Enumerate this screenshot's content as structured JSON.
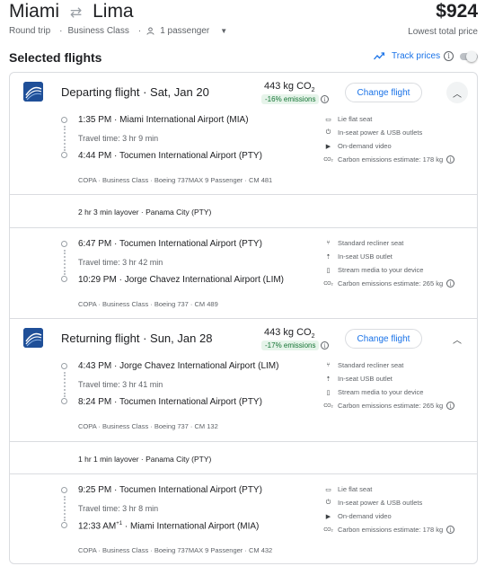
{
  "header": {
    "origin": "Miami",
    "swap_icon": "swap-arrows-icon",
    "destination": "Lima",
    "price": "$924",
    "trip_type": "Round trip",
    "cabin": "Business Class",
    "passengers": "1 passenger",
    "price_note": "Lowest total price"
  },
  "selected": {
    "title": "Selected flights",
    "track_prices": "Track prices",
    "track_enabled": false
  },
  "departing": {
    "title": "Departing flight",
    "date": "Sat, Jan 20",
    "co2": "443 kg CO",
    "co2_sub": "2",
    "emissions": "-16% emissions",
    "change_label": "Change flight",
    "segments": [
      {
        "dep_time": "1:35 PM",
        "dep_airport": "Miami International Airport (MIA)",
        "travel": "Travel time: 3 hr 9 min",
        "arr_time": "4:44 PM",
        "arr_airport": "Tocumen International Airport (PTY)",
        "meta": "COPA · Business Class · Boeing 737MAX 9 Passenger · CM 481",
        "amenities": [
          "Lie flat seat",
          "In-seat power & USB outlets",
          "On-demand video",
          "Carbon emissions estimate: 178 kg"
        ]
      },
      {
        "dep_time": "6:47 PM",
        "dep_airport": "Tocumen International Airport (PTY)",
        "travel": "Travel time: 3 hr 42 min",
        "arr_time": "10:29 PM",
        "arr_airport": "Jorge Chavez International Airport (LIM)",
        "meta": "COPA · Business Class · Boeing 737 · CM 489",
        "amenities": [
          "Standard recliner seat",
          "In-seat USB outlet",
          "Stream media to your device",
          "Carbon emissions estimate: 265 kg"
        ]
      }
    ],
    "layover": "2 hr 3 min layover · Panama City (PTY)"
  },
  "returning": {
    "title": "Returning flight",
    "date": "Sun, Jan 28",
    "co2": "443 kg CO",
    "co2_sub": "2",
    "emissions": "-17% emissions",
    "change_label": "Change flight",
    "segments": [
      {
        "dep_time": "4:43 PM",
        "dep_airport": "Jorge Chavez International Airport (LIM)",
        "travel": "Travel time: 3 hr 41 min",
        "arr_time": "8:24 PM",
        "arr_airport": "Tocumen International Airport (PTY)",
        "meta": "COPA · Business Class · Boeing 737 · CM 132",
        "amenities": [
          "Standard recliner seat",
          "In-seat USB outlet",
          "Stream media to your device",
          "Carbon emissions estimate: 265 kg"
        ]
      },
      {
        "dep_time": "9:25 PM",
        "dep_airport": "Tocumen International Airport (PTY)",
        "travel": "Travel time: 3 hr 8 min",
        "arr_time": "12:33 AM",
        "arr_day_offset": "+1",
        "arr_airport": "Miami International Airport (MIA)",
        "meta": "COPA · Business Class · Boeing 737MAX 9 Passenger · CM 432",
        "amenities": [
          "Lie flat seat",
          "In-seat power & USB outlets",
          "On-demand video",
          "Carbon emissions estimate: 178 kg"
        ]
      }
    ],
    "layover": "1 hr 1 min layover · Panama City (PTY)"
  },
  "colors": {
    "accent": "#1a73e8",
    "emissions_green": "#137333",
    "emissions_bg": "#e6f4ea",
    "logo_blue": "#1f4f98"
  }
}
